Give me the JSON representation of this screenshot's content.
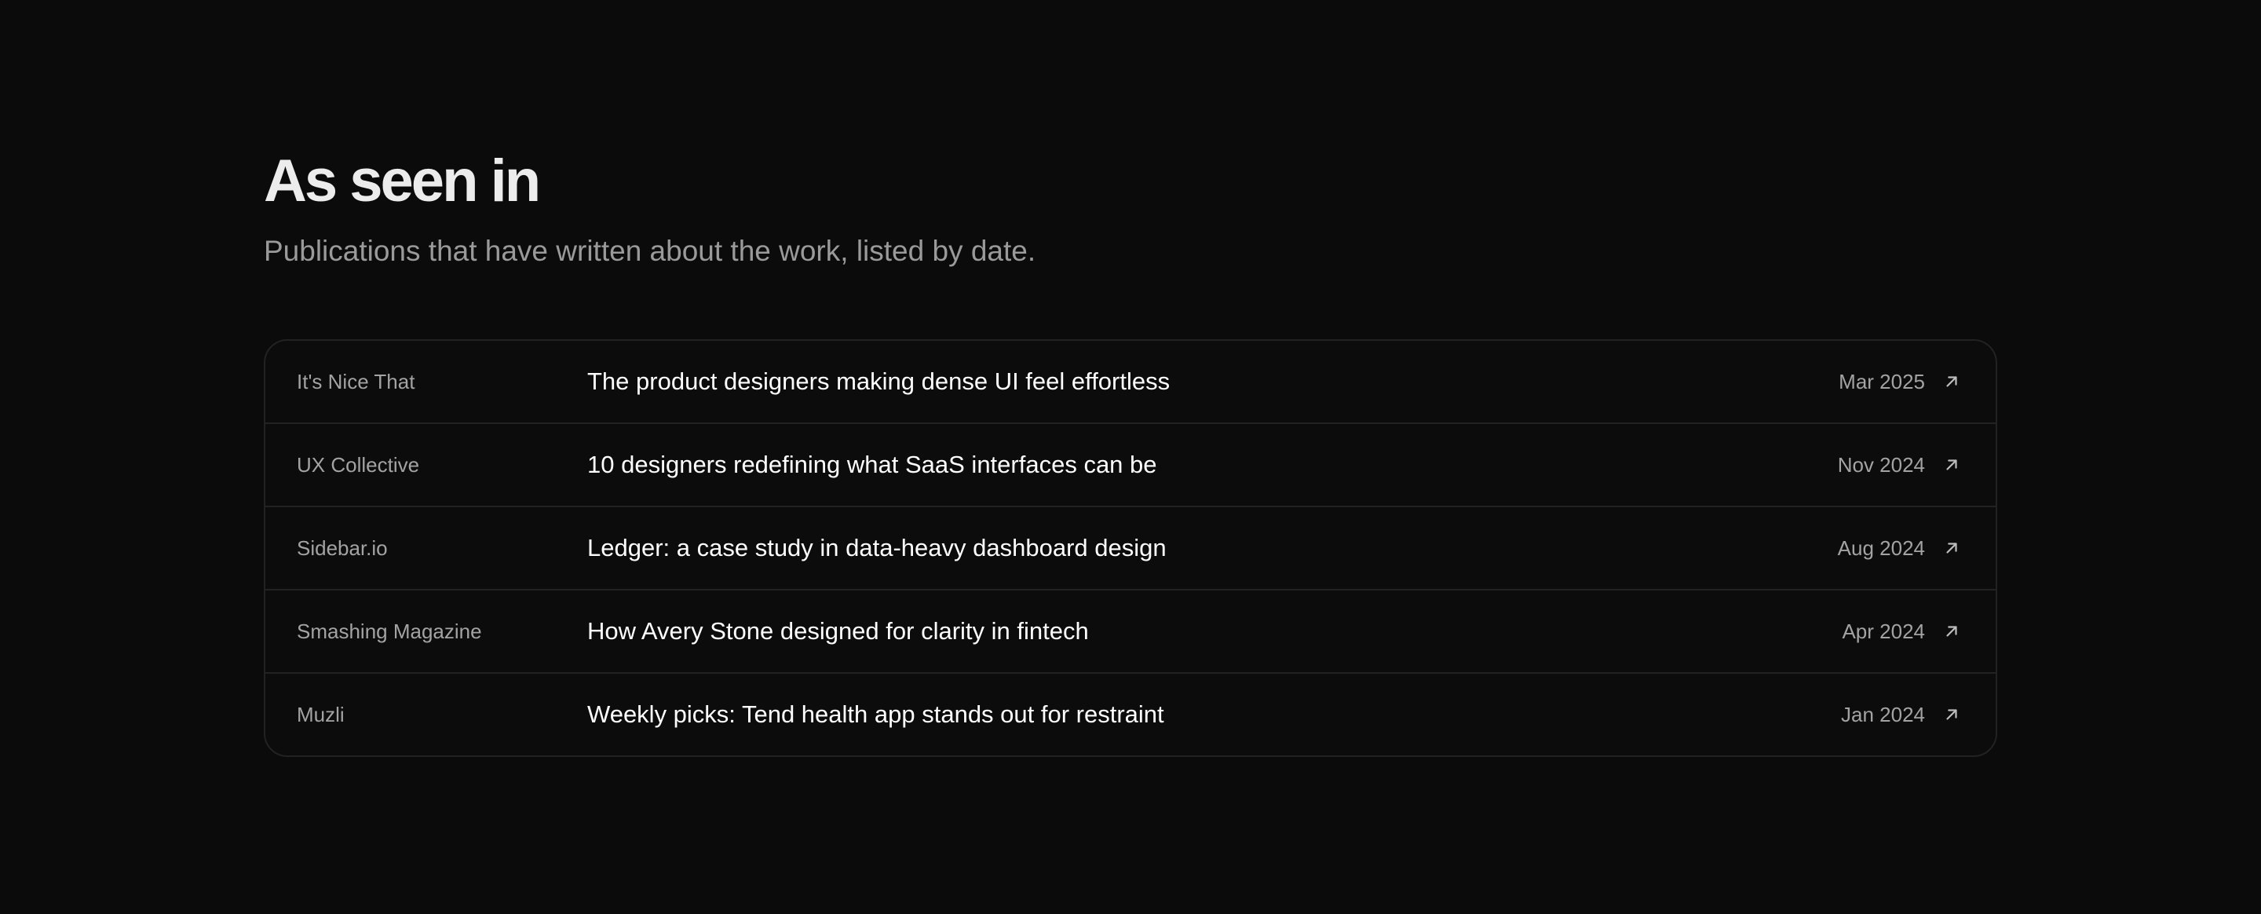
{
  "section": {
    "title": "As seen in",
    "subtitle": "Publications that have written about the work, listed by date."
  },
  "colors": {
    "background": "#0b0b0b",
    "border": "#222222",
    "headline": "#ffffff",
    "muted": "#a3a3a3"
  },
  "press": [
    {
      "publication": "It's Nice That",
      "headline": "The product designers making dense UI feel effortless",
      "date": "Mar 2025",
      "icon": "arrow-up-right-icon"
    },
    {
      "publication": "UX Collective",
      "headline": "10 designers redefining what SaaS interfaces can be",
      "date": "Nov 2024",
      "icon": "arrow-up-right-icon"
    },
    {
      "publication": "Sidebar.io",
      "headline": "Ledger: a case study in data-heavy dashboard design",
      "date": "Aug 2024",
      "icon": "arrow-up-right-icon"
    },
    {
      "publication": "Smashing Magazine",
      "headline": "How Avery Stone designed for clarity in fintech",
      "date": "Apr 2024",
      "icon": "arrow-up-right-icon"
    },
    {
      "publication": "Muzli",
      "headline": "Weekly picks: Tend health app stands out for restraint",
      "date": "Jan 2024",
      "icon": "arrow-up-right-icon"
    }
  ]
}
